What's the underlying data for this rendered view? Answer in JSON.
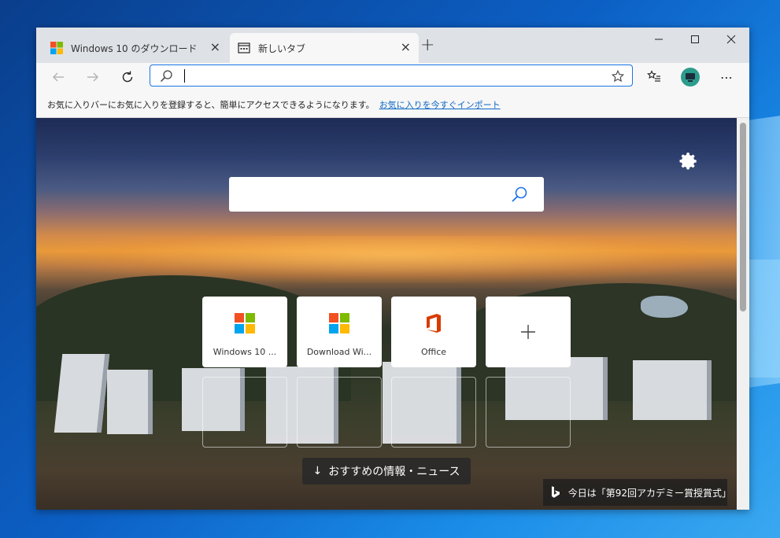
{
  "tabs": [
    {
      "title": "Windows 10 のダウンロード",
      "close": "×",
      "favicon": "windows-logo-icon"
    },
    {
      "title": "新しいタブ",
      "close": "×",
      "favicon": "newtab-page-icon"
    }
  ],
  "new_tab_label": "+",
  "window_controls": {
    "minimize": "minimize-icon",
    "maximize": "maximize-icon",
    "close": "close-icon"
  },
  "toolbar": {
    "back": "back-arrow-icon",
    "forward": "forward-arrow-icon",
    "refresh": "refresh-icon",
    "address_value": "",
    "search_icon": "search-icon",
    "favorite_star": "star-icon",
    "favorites": "favorites-list-icon",
    "profile": "profile-avatar-icon",
    "more": "⋯"
  },
  "favorites_bar": {
    "message": "お気に入りバーにお気に入りを登録すると、簡単にアクセスできるようになります。",
    "link": "お気に入りを今すぐインポート"
  },
  "newtab": {
    "settings_icon": "gear-icon",
    "search_placeholder": "",
    "tiles": [
      {
        "label": "Windows 10 ...",
        "icon": "windows-logo-icon"
      },
      {
        "label": "Download Wi...",
        "icon": "windows-logo-icon"
      },
      {
        "label": "Office",
        "icon": "office-logo-icon"
      },
      {
        "label": "+",
        "icon": "add-icon"
      }
    ],
    "news_button": "おすすめの情報・ニュース",
    "news_arrow": "↓",
    "bing_caption": "今日は「第92回アカデミー賞授賞式」",
    "bing_icon": "bing-logo-icon"
  },
  "colors": {
    "win_red": "#f25022",
    "win_green": "#7fba00",
    "win_blue": "#00a4ef",
    "win_yellow": "#ffb900",
    "office_orange": "#d83b01",
    "link": "#0b66c3",
    "accent": "#1a73e8"
  }
}
